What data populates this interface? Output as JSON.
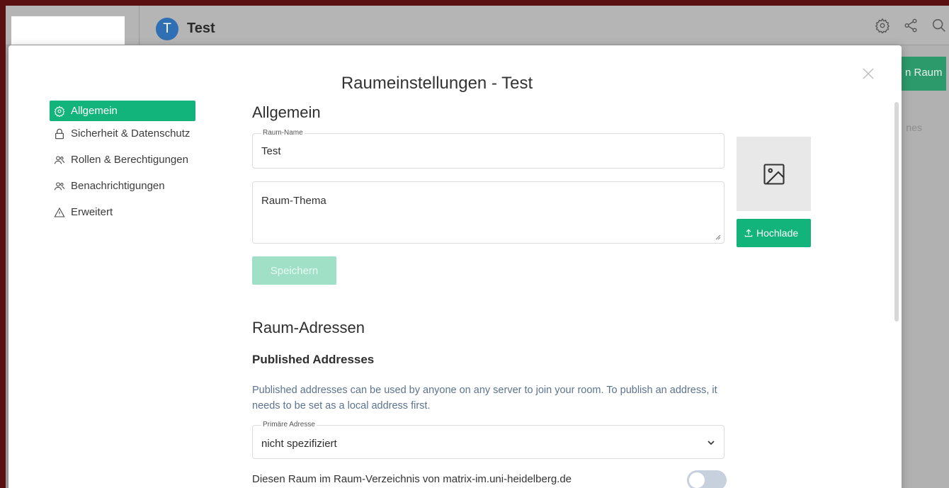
{
  "header": {
    "room_avatar_letter": "T",
    "room_name": "Test"
  },
  "background": {
    "green_button_label": "n Raum",
    "side_text": "nes"
  },
  "modal": {
    "title": "Raumeinstellungen - Test",
    "nav": [
      {
        "label": "Allgemein",
        "icon": "gear-icon",
        "active": true
      },
      {
        "label": "Sicherheit & Datenschutz",
        "icon": "lock-icon",
        "active": false
      },
      {
        "label": "Rollen & Berechtigungen",
        "icon": "users-icon",
        "active": false
      },
      {
        "label": "Benachrichtigungen",
        "icon": "users-icon",
        "active": false
      },
      {
        "label": "Erweitert",
        "icon": "warning-icon",
        "active": false
      }
    ],
    "general": {
      "heading": "Allgemein",
      "room_name_label": "Raum-Name",
      "room_name_value": "Test",
      "topic_placeholder": "Raum-Thema",
      "upload_label": "Hochlade",
      "save_label": "Speichern"
    },
    "addresses": {
      "heading": "Raum-Adressen",
      "published_heading": "Published Addresses",
      "description": "Published addresses can be used by anyone on any server to join your room. To publish an address, it needs to be set as a local address first.",
      "primary_label": "Primäre Adresse",
      "primary_value": "nicht spezifiziert",
      "publish_text": "Diesen Raum im Raum-Verzeichnis von matrix-im.uni-heidelberg.de veröffentlichen?"
    }
  }
}
